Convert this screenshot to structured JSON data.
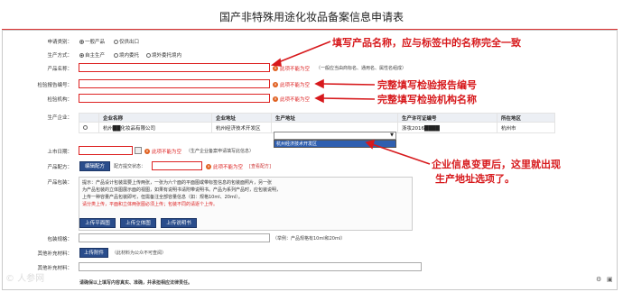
{
  "title": "国产非特殊用途化妆品备案信息申请表",
  "fields": {
    "category_label": "申请类别：",
    "category_opt1": "一般产品",
    "category_opt2": "仅供出口",
    "mode_label": "生产方式：",
    "mode_opt1": "自主生产",
    "mode_opt2": "境内委托",
    "mode_opt3": "境外委托境内",
    "name_label": "产品名称：",
    "name_error": "此项不能为空",
    "name_hint": "（一般应当由商标名、通用名、属性名组成）",
    "report_label": "检验报告编号：",
    "report_error": "此项不能为空",
    "org_label": "检验机构：",
    "org_error": "此项不能为空",
    "company_label": "生产企业：",
    "date_label": "上市日期：",
    "date_error": "此项不能为空",
    "date_hint": "（生产企业备案申请填写此信息）",
    "formula_label": "产品配方：",
    "formula_button": "编辑配方",
    "formula_status_label": "配方提交状态：",
    "formula_error": "此项不能为空",
    "formula_view": "[查看配方]",
    "pack_label": "产品包装：",
    "spec_label": "包装规格：",
    "spec_hint": "（举例：产品规格有10ml和20ml）",
    "other_label": "其他补充材料：",
    "other_button": "上传附件",
    "other_hint": "（此材料为公众不可查阅）",
    "other_item_label": "其他补充材料：",
    "footer_text": "请确保以上填写内容真实、准确，并承担相应法律责任。"
  },
  "callouts": {
    "c1": "填写产品名称，应与标签中的名称完全一致",
    "c2": "完整填写检验报告编号",
    "c3": "完整填写检验机构名称",
    "c4_line1": "企业信息变更后，这里就出现",
    "c4_line2": "生产地址选项了。"
  },
  "company_table": {
    "headers": [
      "企业名称",
      "企业地址",
      "生产地址",
      "生产许可证编号",
      "所在地区"
    ],
    "row": {
      "name": "杭州██化妆品有限公司",
      "address": "杭州经济技术开发区",
      "prod_address": "",
      "license": "浙妆2016████",
      "region": "杭州市"
    },
    "dropdown_option": "杭州经济技术开发区"
  },
  "pack_desc": {
    "line1": "提示：产品设计包装需要上传两张，一张为六个面的平面图或带标签信息的包装面照片，另一张",
    "line2": "为产品包装的立体图展示面的视图，如果有说明书请附带说明书。产品为系列产品时，应包装说明，",
    "line3": "上传一种容量产品包装即可，但需备注全部容量信息（如：规格10ml、20ml）。",
    "red_line": "请分类上传，平面和立体两张图必须上传；包装不同的请逐个上传。",
    "btn1": "上传平面图",
    "btn2": "上传立体图",
    "btn3": "上传说明书"
  },
  "colors": {
    "accent": "#d7191c",
    "button": "#2a4d8c"
  },
  "watermark": "© 人参网"
}
